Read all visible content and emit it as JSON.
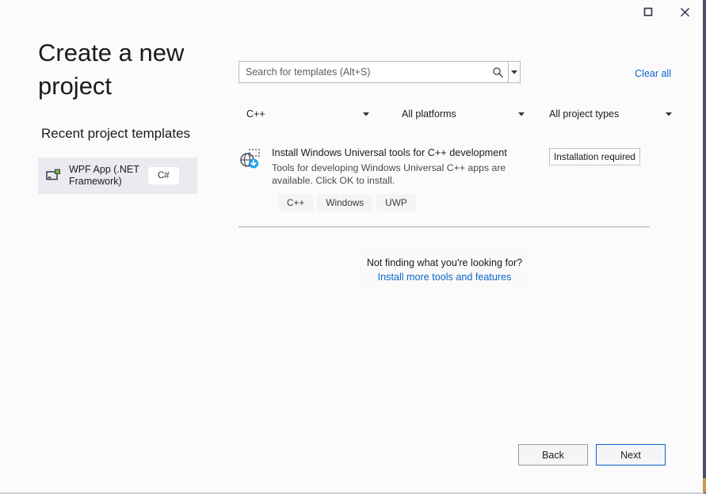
{
  "window": {
    "caption_buttons": [
      {
        "name": "maximize",
        "icon": "maximize-icon",
        "label": "Maximize"
      },
      {
        "name": "close",
        "icon": "close-icon",
        "label": "Close"
      }
    ]
  },
  "left": {
    "title": "Create a new project",
    "recent_heading": "Recent project templates",
    "recent_items": [
      {
        "label": "WPF App (.NET Framework)",
        "language": "C#",
        "icon": "wpf-app-icon",
        "selected": true
      }
    ]
  },
  "search": {
    "placeholder": "Search for templates (Alt+S)",
    "value": "",
    "icon": "search-icon",
    "dropdown_icon": "chevron-down-icon"
  },
  "clear_all_label": "Clear all",
  "filters": [
    {
      "name": "language",
      "value": "C++",
      "icon": "chevron-down-icon"
    },
    {
      "name": "platform",
      "value": "All platforms",
      "icon": "chevron-down-icon"
    },
    {
      "name": "project-type",
      "value": "All project types",
      "icon": "chevron-down-icon"
    }
  ],
  "templates": [
    {
      "title": "Install Windows Universal tools for C++ development",
      "description": "Tools for developing Windows Universal C++ apps are available. Click OK to install.",
      "badge": "Installation required",
      "icon": "globe-download-icon",
      "tags": [
        "C++",
        "Windows",
        "UWP"
      ]
    }
  ],
  "not_finding": {
    "text": "Not finding what you're looking for?",
    "link": "Install more tools and features"
  },
  "footer": {
    "back_label": "Back",
    "next_label": "Next"
  },
  "colors": {
    "accent_link": "#0a64c8",
    "selection_bg": "#eaeaf0",
    "window_border": "#4a5268",
    "corner_accent": "#c89a55",
    "page_bg": "#fbfbfc"
  }
}
